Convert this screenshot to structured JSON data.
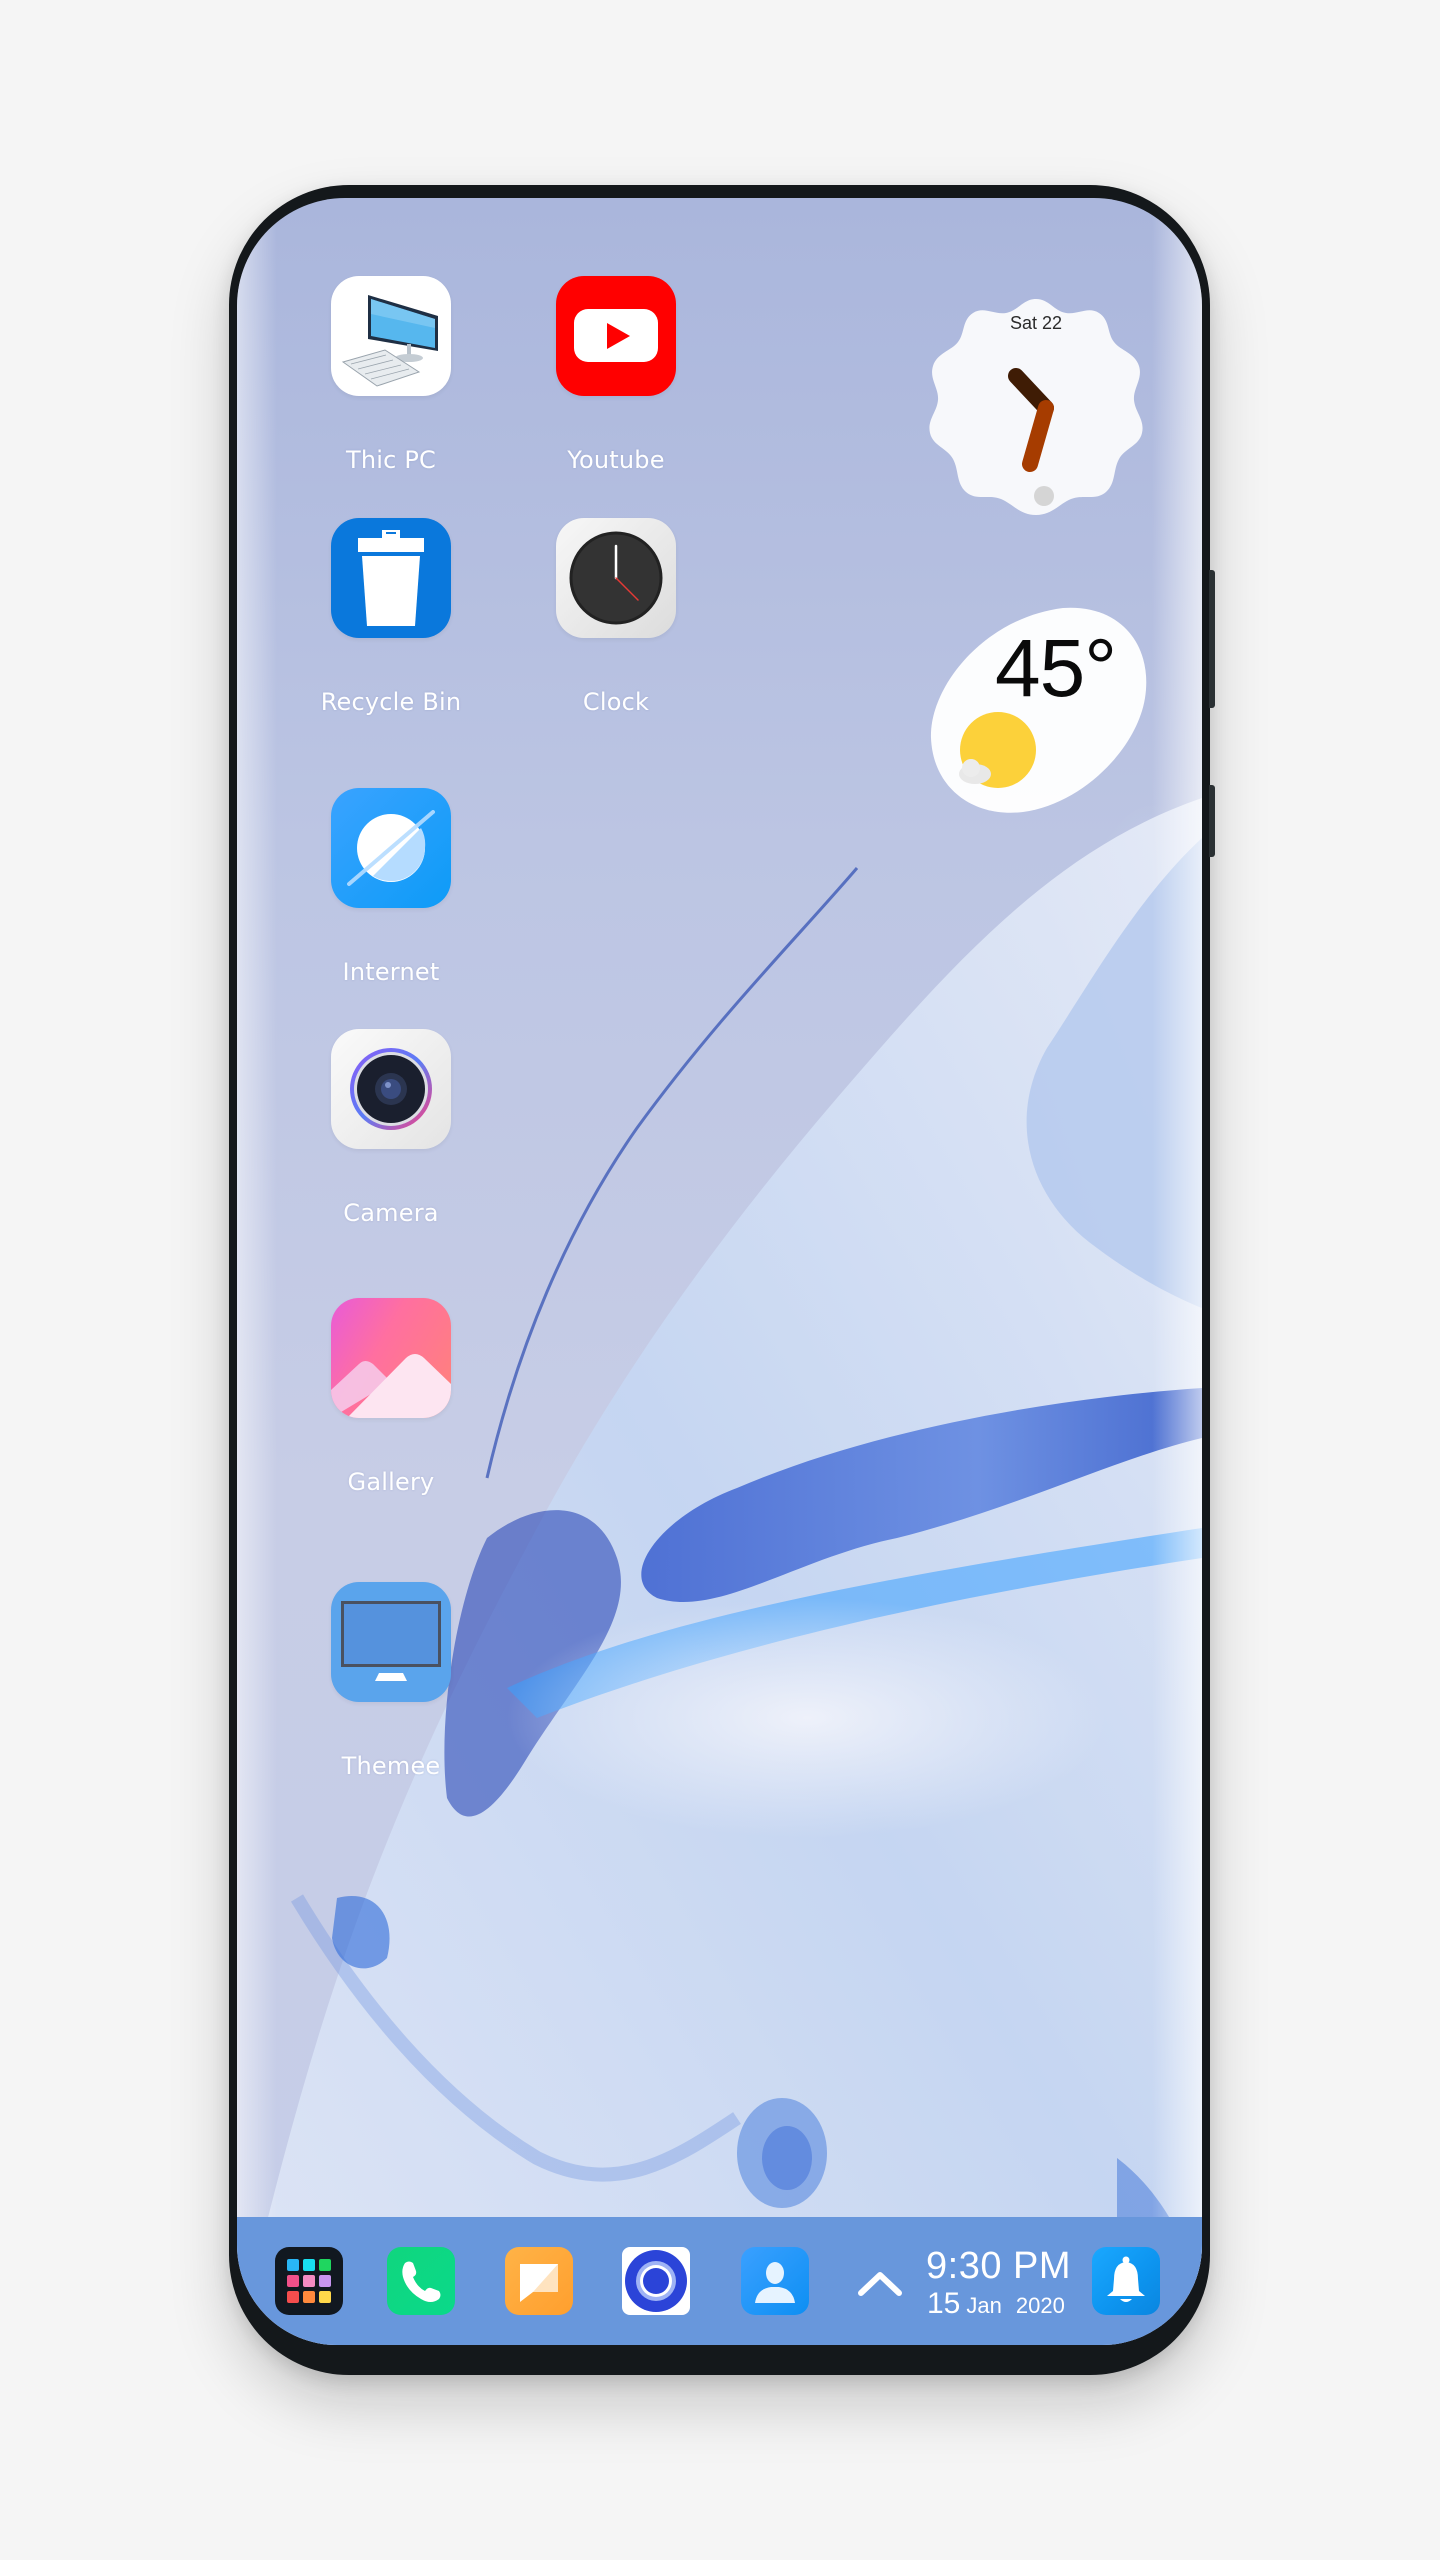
{
  "device": {
    "type": "smartphone-mockup",
    "frame_color": "#14181b",
    "page_background": "#f5f5f5"
  },
  "home_screen": {
    "apps": [
      {
        "label": "Thic PC",
        "icon": "computer-icon",
        "color": "#ffffff"
      },
      {
        "label": "Youtube",
        "icon": "youtube-play-icon",
        "color": "#ff0000"
      },
      {
        "label": "Recycle Bin",
        "icon": "trash-bin-icon",
        "color": "#0a78dc"
      },
      {
        "label": "Clock",
        "icon": "analog-clock-icon",
        "color": "#eeeeee"
      },
      {
        "label": "Internet",
        "icon": "planet-browser-icon",
        "color": "#1e9bff"
      },
      {
        "label": "Camera",
        "icon": "camera-lens-icon",
        "color": "#efefef"
      },
      {
        "label": "Gallery",
        "icon": "mountain-photo-icon",
        "color": "#ff6fa0"
      },
      {
        "label": "Themee",
        "icon": "monitor-icon",
        "color": "#5aa4ec"
      }
    ]
  },
  "widgets": {
    "clock": {
      "date_label": "Sat 22",
      "hour_hand_color": "#3f1c05",
      "minute_hand_color": "#a63c00"
    },
    "weather": {
      "temperature": "45°",
      "condition_icon": "sun-cloud-icon",
      "sun_color": "#fcd13a"
    }
  },
  "dock": {
    "background": "#6897dc",
    "items": [
      {
        "name": "app-drawer",
        "icon": "grid-apps-icon"
      },
      {
        "name": "phone",
        "icon": "phone-icon"
      },
      {
        "name": "messages",
        "icon": "message-note-icon"
      },
      {
        "name": "browser",
        "icon": "ring-circle-icon"
      },
      {
        "name": "contacts",
        "icon": "person-icon"
      }
    ],
    "expand_icon": "chevron-up-icon",
    "time": "9:30 PM",
    "date_day": "15",
    "date_month": "Jan",
    "date_year": "2020",
    "notification_icon": "bell-icon"
  }
}
